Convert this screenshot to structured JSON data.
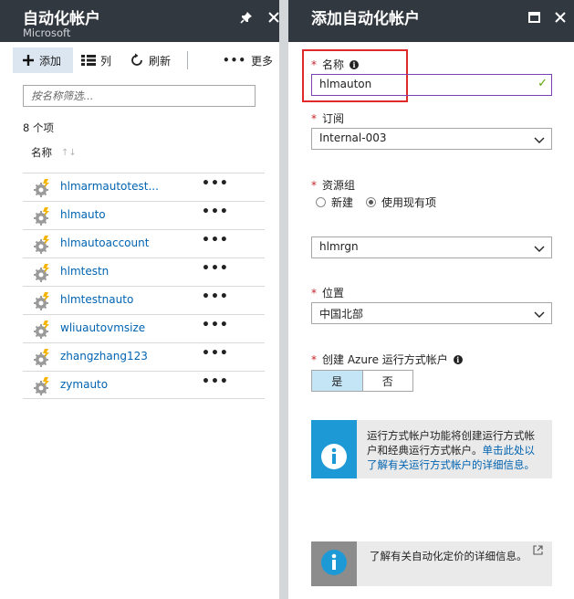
{
  "left_blade": {
    "title": "自动化帐户",
    "subtitle": "Microsoft",
    "toolbar": {
      "add": "添加",
      "columns": "列",
      "refresh": "刷新",
      "more": "更多"
    },
    "filter_placeholder": "按名称筛选...",
    "item_count": "8 个项",
    "column_header": "名称",
    "items": [
      {
        "name": "hlmarmautotest..."
      },
      {
        "name": "hlmauto"
      },
      {
        "name": "hlmautoaccount"
      },
      {
        "name": "hlmtestn"
      },
      {
        "name": "hlmtestnauto"
      },
      {
        "name": "wliuautovmsize"
      },
      {
        "name": "zhangzhang123"
      },
      {
        "name": "zymauto"
      }
    ],
    "row_more": "•••"
  },
  "right_blade": {
    "title": "添加自动化帐户",
    "name_field": {
      "label": "名称",
      "value": "hlmauton"
    },
    "subscription": {
      "label": "订阅",
      "value": "Internal-003"
    },
    "resource_group": {
      "label": "资源组",
      "option_new": "新建",
      "option_existing": "使用现有项",
      "selected": "existing",
      "value": "hlmrgn"
    },
    "location": {
      "label": "位置",
      "value": "中国北部"
    },
    "run_as": {
      "label": "创建 Azure 运行方式帐户",
      "yes": "是",
      "no": "否",
      "selected": "yes"
    },
    "run_as_info": {
      "text": "运行方式帐户功能将创建运行方式帐户和经典运行方式帐户。",
      "link": "单击此处以了解有关运行方式帐户的详细信息。"
    },
    "pricing_info": {
      "text": "了解有关自动化定价的详细信息。"
    }
  },
  "colors": {
    "header_bg": "#32383f",
    "link": "#0063b1",
    "required": "#c4262e",
    "highlight_border": "#e02a2a",
    "info_blue": "#1d9ad6",
    "toggle_selected": "#c4e5f5",
    "valid_check": "#57a300"
  },
  "icons": [
    "pin-icon",
    "close-icon",
    "plus-icon",
    "columns-icon",
    "refresh-icon",
    "automation-account-icon",
    "info-icon",
    "chevron-down-icon",
    "check-icon",
    "maximize-icon",
    "external-link-icon"
  ]
}
